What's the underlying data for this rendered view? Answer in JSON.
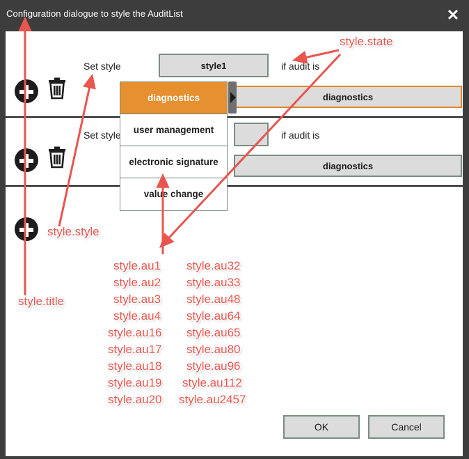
{
  "window": {
    "title": "Configuration dialogue to style the AuditList",
    "close_label": "✕",
    "titlebar_color": "#3d3d3d"
  },
  "colors": {
    "accent_orange": "#e6902f",
    "button_face": "#dcdcdc",
    "button_border": "#7b8d80",
    "annotation_red": "#e8564f",
    "divider": "#1c1c1c"
  },
  "rows": [
    {
      "add_icon": "plus-circle-icon",
      "delete_icon": "trash-icon",
      "set_style_label": "Set style",
      "style_value": "style1",
      "condition_label": "if audit is",
      "state_value": "diagnostics",
      "state_focused": true
    },
    {
      "add_icon": "plus-circle-icon",
      "delete_icon": "trash-icon",
      "set_style_label": "Set style",
      "style_value": "",
      "condition_label": "if audit is",
      "state_value": "diagnostics",
      "state_focused": false
    },
    {
      "add_icon": "plus-circle-icon"
    }
  ],
  "dropdown": {
    "open": true,
    "selected": "diagnostics",
    "items": [
      "diagnostics",
      "user management",
      "electronic signature",
      "value change"
    ],
    "scrollbar": "vertical-scrollbar"
  },
  "annotations": {
    "title": "style.title",
    "style": "style.style",
    "state": "style.state",
    "au_column_left": [
      "style.au1",
      "style.au2",
      "style.au3",
      "style.au4",
      "style.au16",
      "style.au17",
      "style.au18",
      "style.au19",
      "style.au20"
    ],
    "au_column_right": [
      "style.au32",
      "style.au33",
      "style.au48",
      "style.au64",
      "style.au65",
      "style.au80",
      "style.au96",
      "style.au112",
      "style.au2457"
    ]
  },
  "footer": {
    "ok_label": "OK",
    "cancel_label": "Cancel"
  }
}
